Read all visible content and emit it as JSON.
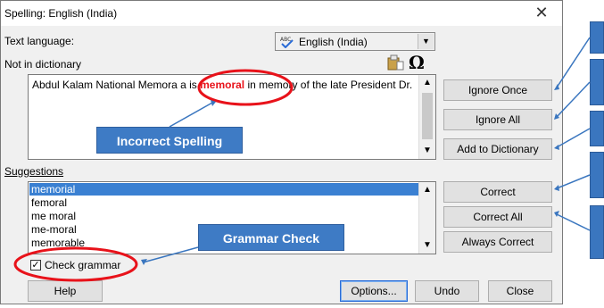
{
  "dialog": {
    "title": "Spelling: English (India)",
    "close_glyph": "✕",
    "text_language_label": "Text language:",
    "language_value": "English (India)",
    "not_in_dictionary_label": "Not in dictionary",
    "sentence_before": "Abdul Kalam National Memora a is ",
    "misspelled_word": "memoral",
    "sentence_after": " in memory of the late President Dr.",
    "suggestions_label": "Suggestions",
    "suggestions": [
      "memorial",
      "femoral",
      "me moral",
      "me-moral",
      "memorable"
    ],
    "check_grammar_label": "Check grammar",
    "check_grammar_checked": true,
    "buttons": {
      "ignore_once": "Ignore Once",
      "ignore_all": "Ignore All",
      "add_to_dictionary": "Add to Dictionary",
      "correct": "Correct",
      "correct_all": "Correct All",
      "always_correct": "Always Correct",
      "help": "Help",
      "options": "Options...",
      "undo": "Undo",
      "close": "Close"
    }
  },
  "annotations": {
    "incorrect_spelling": "Incorrect Spelling",
    "grammar_check": "Grammar Check"
  },
  "colors": {
    "callout_fill": "#3e7bc5",
    "highlight_ring": "#e8121a",
    "arrow": "#3a76bf",
    "selection": "#3a80d2"
  }
}
